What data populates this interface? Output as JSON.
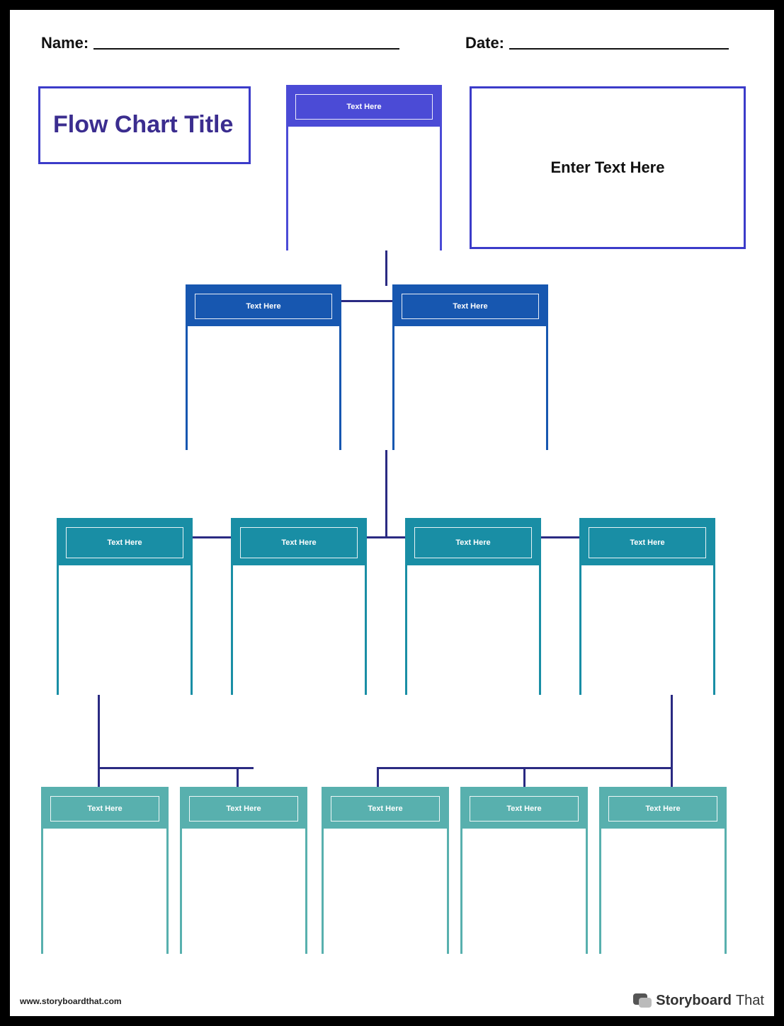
{
  "header": {
    "name_label": "Name:",
    "date_label": "Date:"
  },
  "title": {
    "text": "Flow Chart Title"
  },
  "enter": {
    "text": "Enter Text Here"
  },
  "nodes": {
    "l1_1": "Text Here",
    "l2_1": "Text Here",
    "l2_2": "Text Here",
    "l3_1": "Text Here",
    "l3_2": "Text Here",
    "l3_3": "Text Here",
    "l3_4": "Text Here",
    "l4_1": "Text Here",
    "l4_2": "Text Here",
    "l4_3": "Text Here",
    "l4_4": "Text Here",
    "l4_5": "Text Here"
  },
  "footer": {
    "url": "www.storyboardthat.com",
    "brand_a": "Storyboard",
    "brand_b": "That"
  },
  "colors": {
    "purple": "#4b4bd6",
    "blue": "#1757b0",
    "teal": "#198ea5",
    "sea": "#58b0ae",
    "line": "#2a2a82"
  }
}
